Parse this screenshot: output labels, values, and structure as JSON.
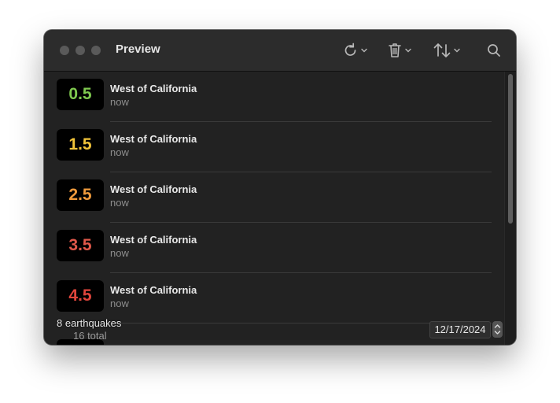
{
  "window": {
    "title": "Preview"
  },
  "toolbar": {
    "refresh_icon": "refresh-icon",
    "trash_icon": "trash-icon",
    "sort_icon": "sort-icon",
    "search_icon": "search-icon"
  },
  "earthquakes": [
    {
      "magnitude": "0.5",
      "place": "West of California",
      "time": "now",
      "color": "#7fc94f"
    },
    {
      "magnitude": "1.5",
      "place": "West of California",
      "time": "now",
      "color": "#f2c43a"
    },
    {
      "magnitude": "2.5",
      "place": "West of California",
      "time": "now",
      "color": "#ef9a3c"
    },
    {
      "magnitude": "3.5",
      "place": "West of California",
      "time": "now",
      "color": "#e0584a"
    },
    {
      "magnitude": "4.5",
      "place": "West of California",
      "time": "now",
      "color": "#e0453c"
    }
  ],
  "footer": {
    "count": "8 earthquakes",
    "total": "16 total",
    "date": "12/17/2024"
  }
}
